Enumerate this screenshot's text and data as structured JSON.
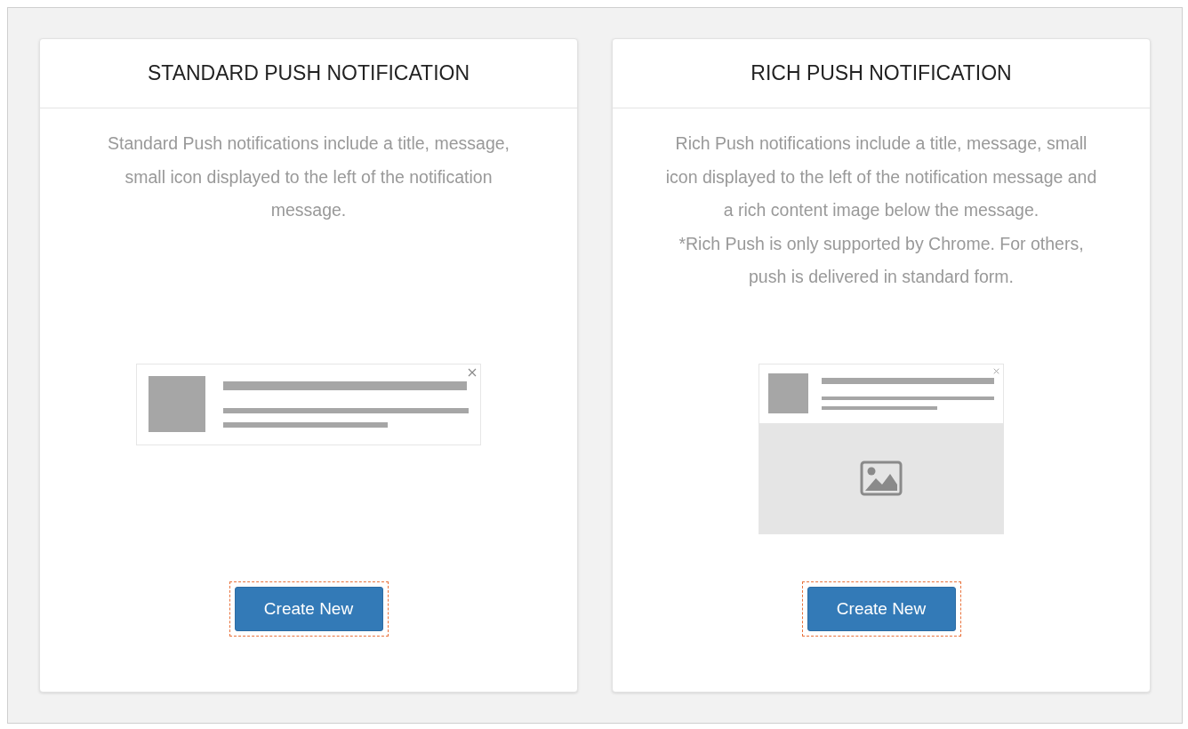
{
  "cards": [
    {
      "title": "STANDARD PUSH NOTIFICATION",
      "description": [
        "Standard Push notifications include a title, message, small icon displayed to the left of the notification message."
      ],
      "preview": {
        "kind": "standard"
      },
      "button": {
        "label": "Create New",
        "highlighted": true
      }
    },
    {
      "title": "RICH PUSH NOTIFICATION",
      "description": [
        "Rich Push notifications include a title, message, small icon displayed to the left of the notification message and a rich content image below the message.",
        "*Rich Push is only supported by Chrome. For others, push is delivered in standard form."
      ],
      "preview": {
        "kind": "rich"
      },
      "button": {
        "label": "Create New",
        "highlighted": true
      }
    }
  ]
}
